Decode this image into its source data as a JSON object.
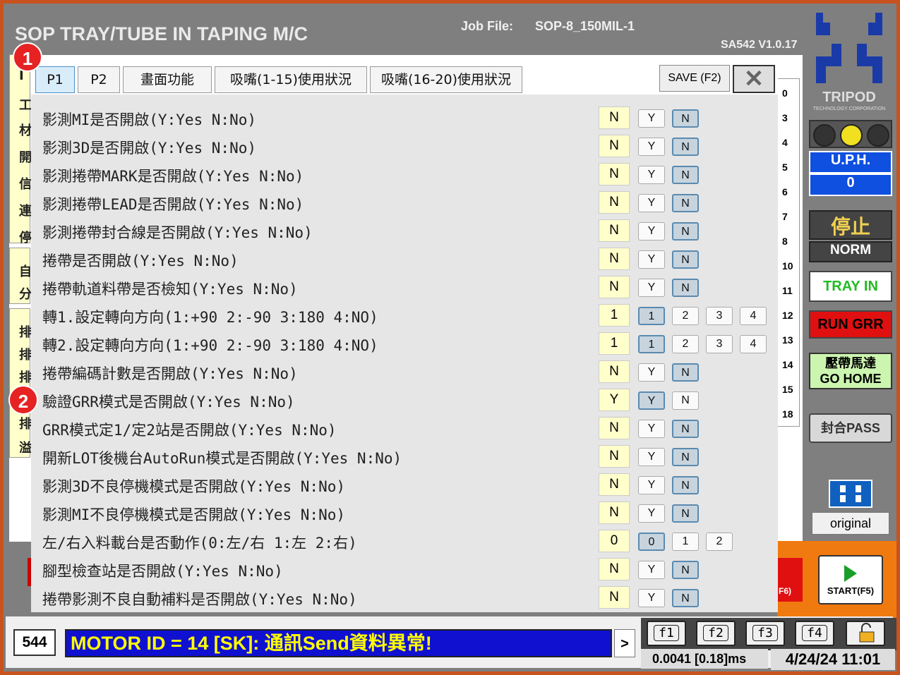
{
  "header": {
    "title": "SOP TRAY/TUBE IN TAPING M/C",
    "job_label": "Job File:",
    "job_value": "SOP-8_150MIL-1",
    "version": "SA542  V1.0.17"
  },
  "background_numbers": [
    "0",
    "3",
    "4",
    "5",
    "6",
    "7",
    "8",
    "10",
    "11",
    "12",
    "13",
    "14",
    "15",
    "18"
  ],
  "background_left_chars": [
    "I",
    "工",
    "材",
    "開",
    "信",
    "連",
    "停",
    "自",
    "分",
    "排",
    "排",
    "排",
    "排",
    "溢"
  ],
  "sidebar": {
    "brand": "TRIPOD",
    "brand_sub": "TECHNOLOGY CORPORATION",
    "uph_label": "U.P.H.",
    "uph_value": "0",
    "stop": "停止",
    "norm": "NORM",
    "tray_in": "TRAY  IN",
    "run_grr": "RUN GRR",
    "go_home_line1": "壓帶馬達",
    "go_home_line2": "GO HOME",
    "seal_pass": "封合PASS",
    "original": "original"
  },
  "bottom": {
    "count": "544",
    "message": "MOTOR ID = 14 [SK]: 通訊Send資料異常!",
    "arrow": ">",
    "fkeys": [
      "f1",
      "f2",
      "f3",
      "f4"
    ],
    "timing": "0.0041 [0.18]ms",
    "datetime": "4/24/24 11:01",
    "start_label": "START(F5)",
    "f6_label": "F6)"
  },
  "dialog": {
    "tabs": [
      "P1",
      "P2",
      "畫面功能",
      "吸嘴(1-15)使用狀況",
      "吸嘴(16-20)使用狀況"
    ],
    "active_tab": "P1",
    "save": "SAVE (F2)",
    "rows": [
      {
        "label": "影測MI是否開啟(Y:Yes N:No)",
        "value": "N",
        "options": [
          "Y",
          "N"
        ],
        "selected": "N"
      },
      {
        "label": "影測3D是否開啟(Y:Yes N:No)",
        "value": "N",
        "options": [
          "Y",
          "N"
        ],
        "selected": "N"
      },
      {
        "label": "影測捲帶MARK是否開啟(Y:Yes N:No)",
        "value": "N",
        "options": [
          "Y",
          "N"
        ],
        "selected": "N"
      },
      {
        "label": "影測捲帶LEAD是否開啟(Y:Yes N:No)",
        "value": "N",
        "options": [
          "Y",
          "N"
        ],
        "selected": "N"
      },
      {
        "label": "影測捲帶封合線是否開啟(Y:Yes N:No)",
        "value": "N",
        "options": [
          "Y",
          "N"
        ],
        "selected": "N"
      },
      {
        "label": "捲帶是否開啟(Y:Yes N:No)",
        "value": "N",
        "options": [
          "Y",
          "N"
        ],
        "selected": "N"
      },
      {
        "label": "捲帶軌道料帶是否檢知(Y:Yes N:No)",
        "value": "N",
        "options": [
          "Y",
          "N"
        ],
        "selected": "N"
      },
      {
        "label": "轉1.設定轉向方向(1:+90  2:-90  3:180  4:NO)",
        "value": "1",
        "options": [
          "1",
          "2",
          "3",
          "4"
        ],
        "selected": "1"
      },
      {
        "label": "轉2.設定轉向方向(1:+90  2:-90  3:180  4:NO)",
        "value": "1",
        "options": [
          "1",
          "2",
          "3",
          "4"
        ],
        "selected": "1"
      },
      {
        "label": "捲帶編碼計數是否開啟(Y:Yes N:No)",
        "value": "N",
        "options": [
          "Y",
          "N"
        ],
        "selected": "N"
      },
      {
        "label": "驗證GRR模式是否開啟(Y:Yes N:No)",
        "value": "Y",
        "options": [
          "Y",
          "N"
        ],
        "selected": "Y"
      },
      {
        "label": "GRR模式定1/定2站是否開啟(Y:Yes N:No)",
        "value": "N",
        "options": [
          "Y",
          "N"
        ],
        "selected": "N"
      },
      {
        "label": "開新LOT後機台AutoRun模式是否開啟(Y:Yes N:No)",
        "value": "N",
        "options": [
          "Y",
          "N"
        ],
        "selected": "N"
      },
      {
        "label": "影測3D不良停機模式是否開啟(Y:Yes N:No)",
        "value": "N",
        "options": [
          "Y",
          "N"
        ],
        "selected": "N"
      },
      {
        "label": "影測MI不良停機模式是否開啟(Y:Yes N:No)",
        "value": "N",
        "options": [
          "Y",
          "N"
        ],
        "selected": "N"
      },
      {
        "label": "左/右入料載台是否動作(0:左/右 1:左 2:右)",
        "value": "0",
        "options": [
          "0",
          "1",
          "2"
        ],
        "selected": "0"
      },
      {
        "label": "腳型檢查站是否開啟(Y:Yes N:No)",
        "value": "N",
        "options": [
          "Y",
          "N"
        ],
        "selected": "N"
      },
      {
        "label": "捲帶影測不良自動補料是否開啟(Y:Yes N:No)",
        "value": "N",
        "options": [
          "Y",
          "N"
        ],
        "selected": "N"
      }
    ]
  },
  "markers": [
    "1",
    "2"
  ],
  "colors": {
    "accent": "#1050e0",
    "border": "#c8531e",
    "message_bg": "#1010d0",
    "message_fg": "#ffff00"
  }
}
